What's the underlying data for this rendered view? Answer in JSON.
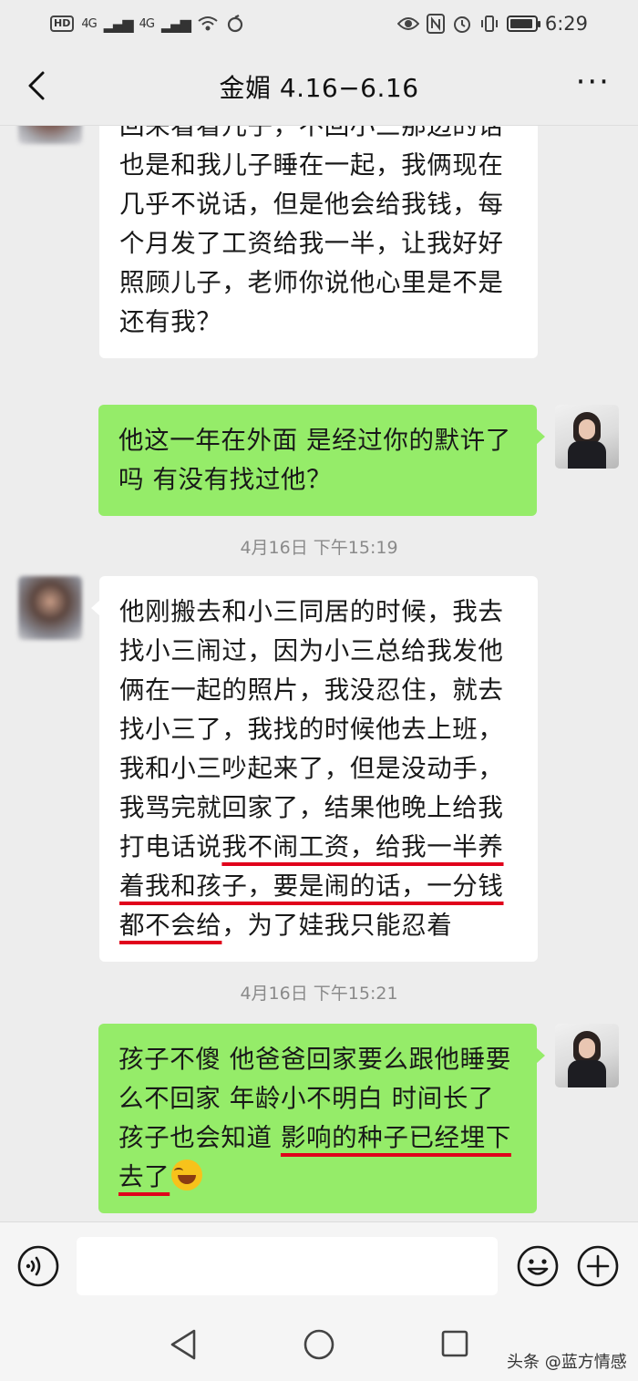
{
  "status_bar": {
    "left": {
      "hd": "HD",
      "net1": "4G",
      "net2": "4G"
    },
    "time": "6:29"
  },
  "header": {
    "title": "金媚 4.16−6.16"
  },
  "messages": [
    {
      "side": "left",
      "text": "现在我和儿子两个人住家，他偶尔回来看看儿子，不回小三那边的话也是和我儿子睡在一起，我俩现在几乎不说话，但是他会给我钱，每个月发了工资给我一半，让我好好照顾儿子，老师你说他心里是不是还有我？"
    },
    {
      "side": "right",
      "text": "他这一年在外面 是经过你的默许了吗 有没有找过他？"
    },
    {
      "side": "left",
      "parts": {
        "before": "他刚搬去和小三同居的时候，我去找小三闹过，因为小三总给我发他俩在一起的照片，我没忍住，就去找小三了，我找的时候他去上班，我和小三吵起来了，但是没动手，我骂完就回家了，结果他晚上给我打电话说",
        "highlight": "我不闹工资，给我一半养着我和孩子，要是闹的话，一分钱都不会给",
        "after": "，为了娃我只能忍着"
      }
    },
    {
      "side": "right",
      "parts": {
        "before": "孩子不傻 他爸爸回家要么跟他睡要么不回家 年龄小不明白 时间长了孩子也会知道 ",
        "highlight": "影响的种子已经埋下去了",
        "emoji": "facepalm-laughing-emoji"
      }
    }
  ],
  "timestamps": [
    "4月16日 下午15:19",
    "4月16日 下午15:21"
  ],
  "input": {
    "value": "",
    "placeholder": ""
  },
  "watermark": "头条 @蓝方情感",
  "colors": {
    "self_bubble": "#95ec69",
    "other_bubble": "#ffffff",
    "background": "#ededed",
    "highlight_underline": "#e0001b"
  }
}
